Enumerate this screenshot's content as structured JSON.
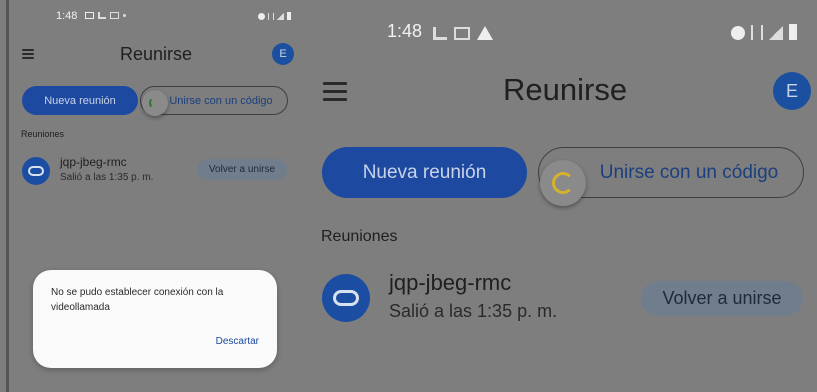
{
  "status": {
    "time": "1:48"
  },
  "app": {
    "title": "Reunirse",
    "avatar_letter": "E"
  },
  "actions": {
    "new_meeting": "Nueva reunión",
    "join_with_code": "Unirse con un código"
  },
  "meetings": {
    "section_label": "Reuniones",
    "items": [
      {
        "code": "jqp-jbeg-rmc",
        "subtitle": "Salió a las 1:35 p. m.",
        "rejoin_label": "Volver a unirse"
      }
    ]
  },
  "dialog": {
    "message": "No se pudo establecer conexión con la videollamada",
    "dismiss_label": "Descartar"
  },
  "icons": [
    "menu-icon",
    "link-icon",
    "loading-spinner-icon",
    "gallery-icon",
    "mail-icon",
    "warning-icon",
    "alarm-icon",
    "4g-icon",
    "signal-icon",
    "battery-icon"
  ],
  "colors": {
    "accent": "#1d4aa0",
    "scrim": "#7e7e7e",
    "dialog": "#fafafa"
  }
}
